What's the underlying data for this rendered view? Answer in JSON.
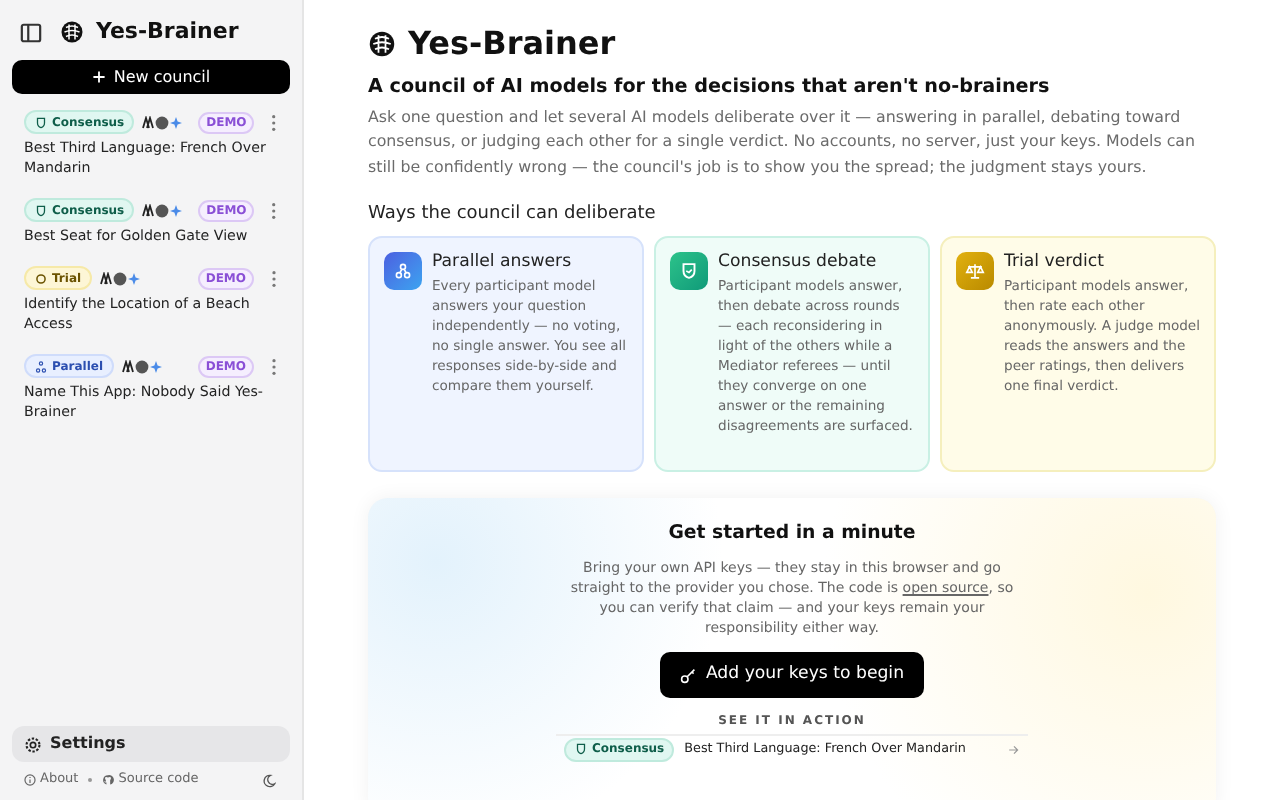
{
  "sidebar": {
    "title": "Yes-Brainer",
    "new_button": "New council",
    "councils": [
      {
        "kind": "consensus",
        "mode_label": "Consensus",
        "badge": "DEMO",
        "title": "Best Third Language: French Over Mandarin"
      },
      {
        "kind": "consensus",
        "mode_label": "Consensus",
        "badge": "DEMO",
        "title": "Best Seat for Golden Gate View"
      },
      {
        "kind": "trial",
        "mode_label": "Trial",
        "badge": "DEMO",
        "title": "Identify the Location of a Beach Access"
      },
      {
        "kind": "parallel",
        "mode_label": "Parallel",
        "badge": "DEMO",
        "title": "Name This App: Nobody Said Yes-Brainer"
      }
    ],
    "settings": "Settings",
    "about": "About",
    "source": "Source code"
  },
  "main": {
    "title": "Yes-Brainer",
    "subtitle": "A council of AI models for the decisions that aren't no-brainers",
    "intro": "Ask one question and let several AI models deliberate over it — answering in parallel, debating toward consensus, or judging each other for a single verdict. No accounts, no server, just your keys. Models can still be confidently wrong — the council's job is to show you the spread; the judgment stays yours.",
    "ways_heading": "Ways the council can deliberate",
    "modes": [
      {
        "kind": "parallel",
        "title": "Parallel answers",
        "text": "Every participant model answers your question independently — no voting, no single answer. You see all responses side-by-side and compare them yourself."
      },
      {
        "kind": "consensus",
        "title": "Consensus debate",
        "text": "Participant models answer, then debate across rounds — each reconsidering in light of the others while a Mediator referees — until they converge on one answer or the remaining disagreements are surfaced."
      },
      {
        "kind": "trial",
        "title": "Trial verdict",
        "text": "Participant models answer, then rate each other anonymously. A judge model reads the answers and the peer ratings, then delivers one final verdict."
      }
    ],
    "start": {
      "heading": "Get started in a minute",
      "text_before": "Bring your own API keys — they stay in this browser and go straight to the provider you chose. The code is",
      "link": "open source",
      "text_after": ", so you can verify that claim — and your keys remain your responsibility either way.",
      "button": "Add your keys to begin",
      "see_label": "SEE IT IN ACTION",
      "example": {
        "kind": "consensus",
        "mode_label": "Consensus",
        "title": "Best Third Language: French Over Mandarin"
      }
    }
  }
}
